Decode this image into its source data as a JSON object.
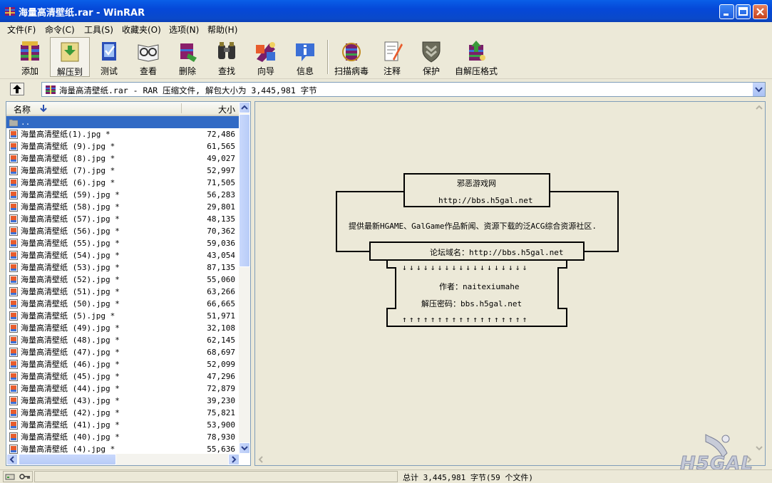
{
  "window": {
    "title": "海量高清壁纸.rar - WinRAR"
  },
  "menu": [
    "文件(F)",
    "命令(C)",
    "工具(S)",
    "收藏夹(O)",
    "选项(N)",
    "帮助(H)"
  ],
  "toolbar": [
    {
      "label": "添加",
      "icon": "add-archive-icon"
    },
    {
      "label": "解压到",
      "icon": "extract-to-icon"
    },
    {
      "label": "测试",
      "icon": "test-icon"
    },
    {
      "label": "查看",
      "icon": "view-icon"
    },
    {
      "label": "删除",
      "icon": "delete-icon"
    },
    {
      "label": "查找",
      "icon": "find-icon"
    },
    {
      "label": "向导",
      "icon": "wizard-icon"
    },
    {
      "label": "信息",
      "icon": "info-icon"
    },
    {
      "label": "扫描病毒",
      "icon": "virus-scan-icon"
    },
    {
      "label": "注释",
      "icon": "comment-icon"
    },
    {
      "label": "保护",
      "icon": "protect-icon"
    },
    {
      "label": "自解压格式",
      "icon": "sfx-icon"
    }
  ],
  "address": {
    "text": "海量高清壁纸.rar - RAR 压缩文件, 解包大小为 3,445,981 字节"
  },
  "list": {
    "col_name": "名称",
    "col_size": "大小",
    "parent": "..",
    "files": [
      {
        "name": "海量高清壁纸(1).jpg *",
        "size": "72,486"
      },
      {
        "name": "海量高清壁纸 (9).jpg *",
        "size": "61,565"
      },
      {
        "name": "海量高清壁纸 (8).jpg *",
        "size": "49,027"
      },
      {
        "name": "海量高清壁纸 (7).jpg *",
        "size": "52,997"
      },
      {
        "name": "海量高清壁纸 (6).jpg *",
        "size": "71,505"
      },
      {
        "name": "海量高清壁纸 (59).jpg *",
        "size": "56,283"
      },
      {
        "name": "海量高清壁纸 (58).jpg *",
        "size": "29,801"
      },
      {
        "name": "海量高清壁纸 (57).jpg *",
        "size": "48,135"
      },
      {
        "name": "海量高清壁纸 (56).jpg *",
        "size": "70,362"
      },
      {
        "name": "海量高清壁纸 (55).jpg *",
        "size": "59,036"
      },
      {
        "name": "海量高清壁纸 (54).jpg *",
        "size": "43,054"
      },
      {
        "name": "海量高清壁纸 (53).jpg *",
        "size": "87,135"
      },
      {
        "name": "海量高清壁纸 (52).jpg *",
        "size": "55,060"
      },
      {
        "name": "海量高清壁纸 (51).jpg *",
        "size": "63,266"
      },
      {
        "name": "海量高清壁纸 (50).jpg *",
        "size": "66,665"
      },
      {
        "name": "海量高清壁纸 (5).jpg *",
        "size": "51,971"
      },
      {
        "name": "海量高清壁纸 (49).jpg *",
        "size": "32,108"
      },
      {
        "name": "海量高清壁纸 (48).jpg *",
        "size": "62,145"
      },
      {
        "name": "海量高清壁纸 (47).jpg *",
        "size": "68,697"
      },
      {
        "name": "海量高清壁纸 (46).jpg *",
        "size": "52,099"
      },
      {
        "name": "海量高清壁纸 (45).jpg *",
        "size": "47,296"
      },
      {
        "name": "海量高清壁纸 (44).jpg *",
        "size": "72,879"
      },
      {
        "name": "海量高清壁纸 (43).jpg *",
        "size": "39,230"
      },
      {
        "name": "海量高清壁纸 (42).jpg *",
        "size": "75,821"
      },
      {
        "name": "海量高清壁纸 (41).jpg *",
        "size": "53,900"
      },
      {
        "name": "海量高清壁纸 (40).jpg *",
        "size": "78,930"
      },
      {
        "name": "海量高清壁纸 (4).jpg *",
        "size": "55,636"
      }
    ]
  },
  "comment": {
    "site_name": "邪恶游戏网",
    "site_url": "http://bbs.h5gal.net",
    "description": "提供最新HGAME、GalGame作品新闻、资源下载的泛ACG综合资源社区.",
    "forum": "论坛域名：http://bbs.h5gal.net",
    "down_arrows": "↓↓↓↓↓↓↓↓↓↓↓↓↓↓↓↓↓↓",
    "author": "作者：naitexiumahe",
    "password": "解压密码：bbs.h5gal.net",
    "up_arrows": "↑↑↑↑↑↑↑↑↑↑↑↑↑↑↑↑↑↑"
  },
  "status": {
    "text": "总计 3,445,981 字节(59 个文件)"
  },
  "watermark": "H5GAL"
}
